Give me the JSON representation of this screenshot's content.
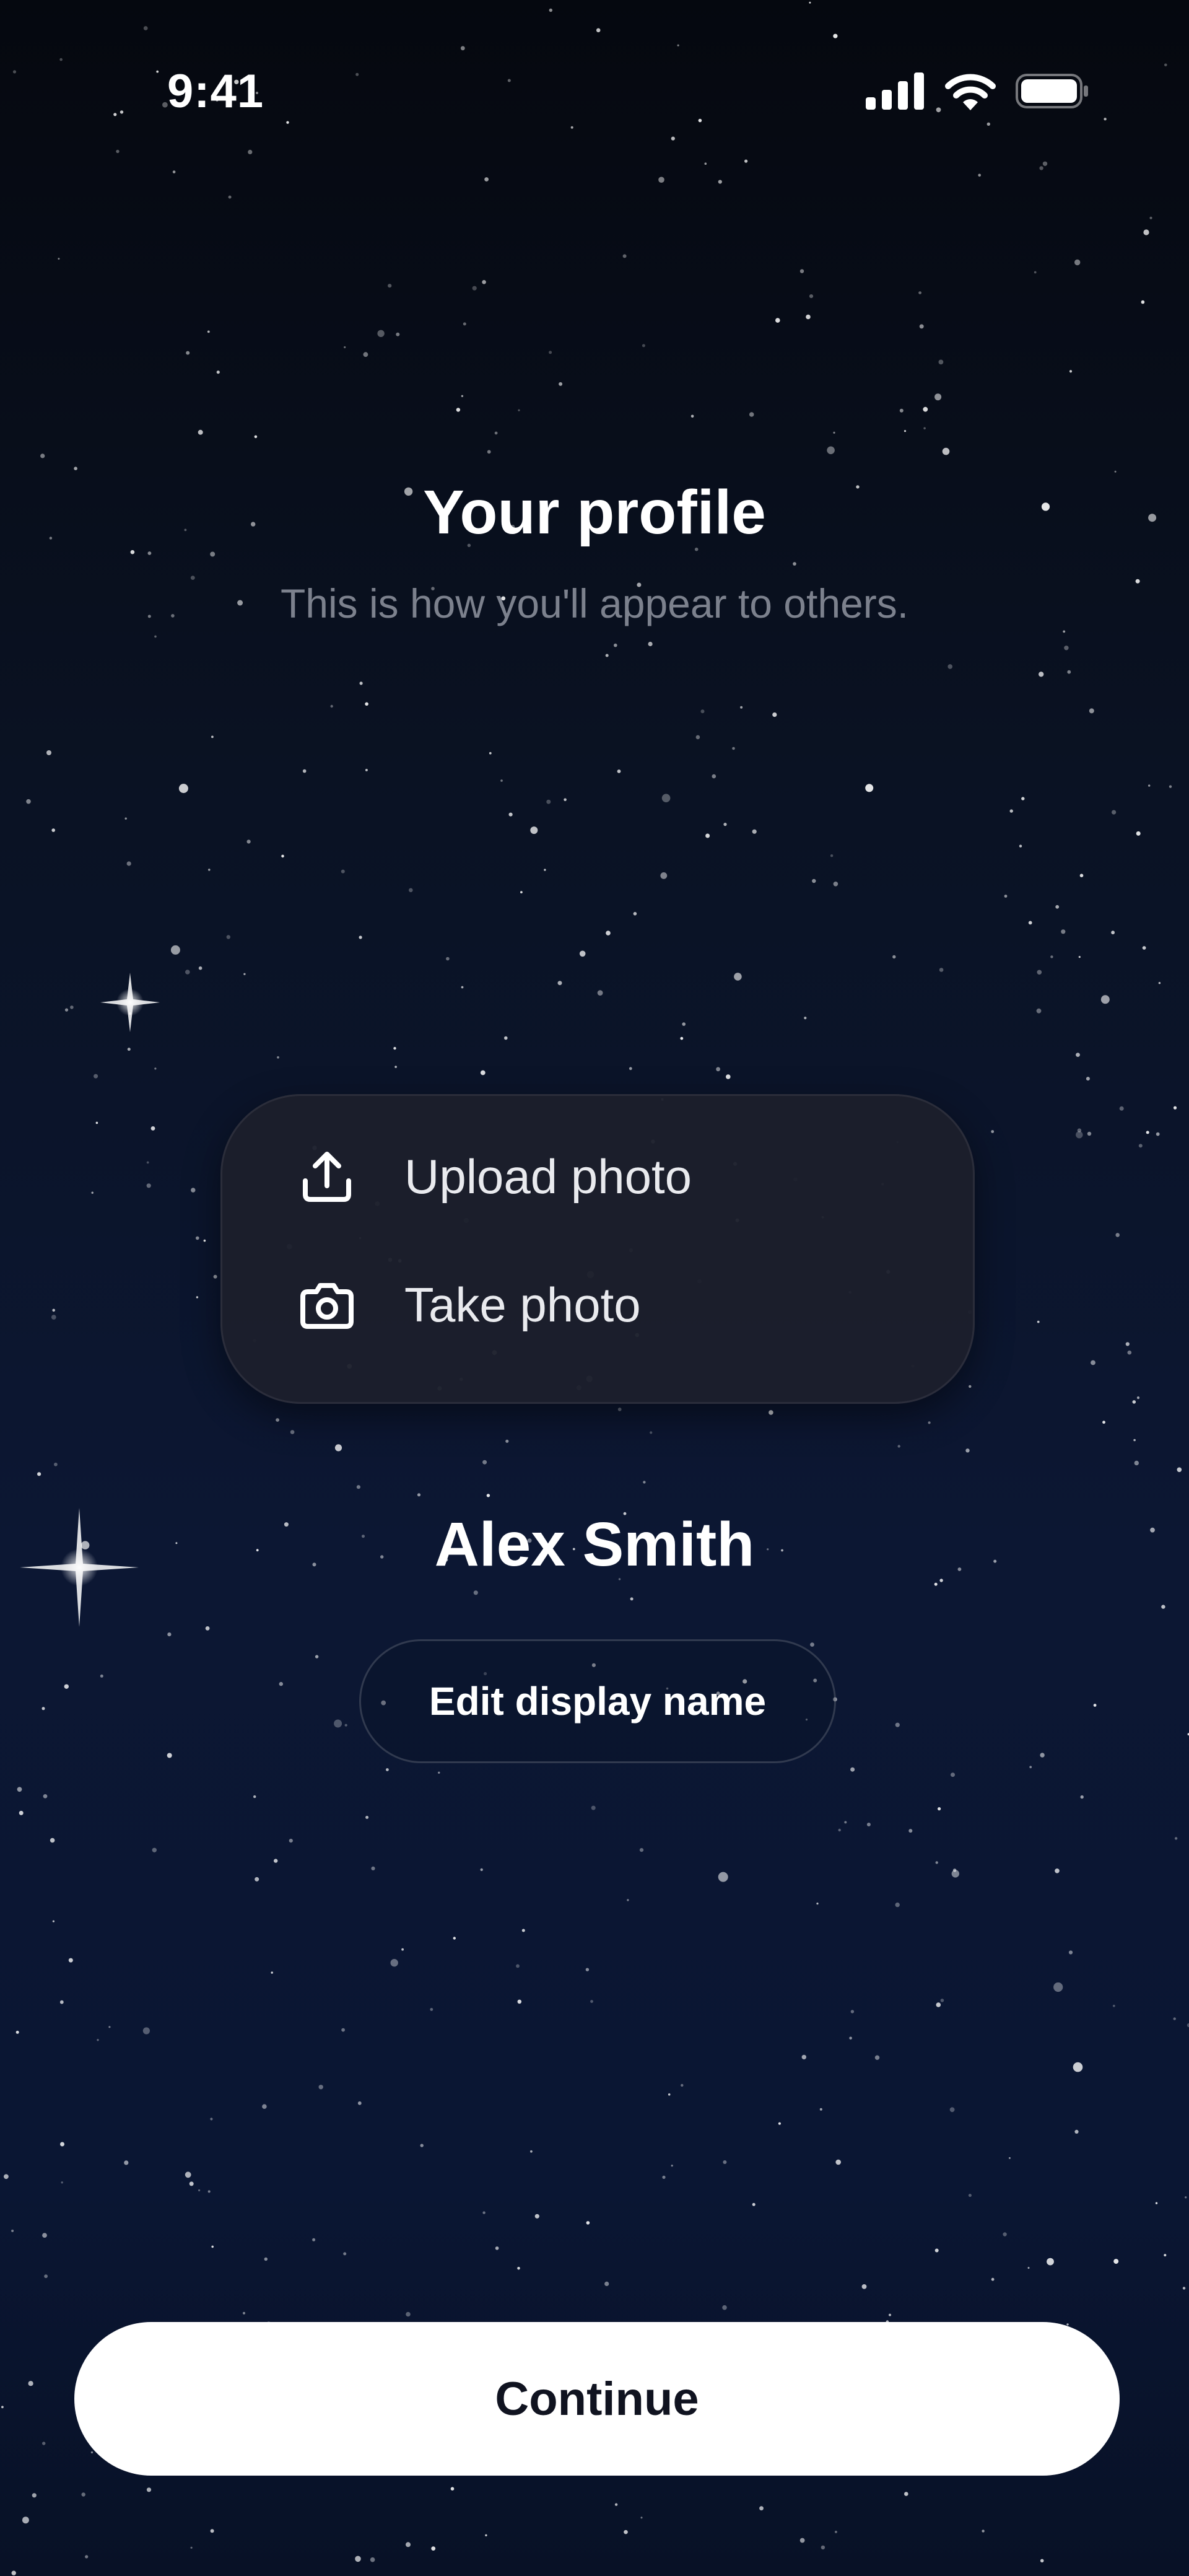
{
  "status_bar": {
    "time": "9:41",
    "icons": [
      "cellular-signal-icon",
      "wifi-icon",
      "battery-icon"
    ]
  },
  "header": {
    "title": "Your profile",
    "subtitle": "This is how you'll appear to others."
  },
  "photo_menu": {
    "items": [
      {
        "label": "Upload photo",
        "icon": "upload-icon"
      },
      {
        "label": "Take photo",
        "icon": "camera-icon"
      }
    ]
  },
  "profile": {
    "display_name": "Alex Smith",
    "edit_label": "Edit display name"
  },
  "footer": {
    "continue_label": "Continue"
  },
  "colors": {
    "background_top": "#05080f",
    "background_bottom": "#0c1733",
    "menu_background": "#1c1f2c",
    "subtitle_text": "#7c818d",
    "button_background": "#ffffff",
    "button_text": "#101320"
  }
}
